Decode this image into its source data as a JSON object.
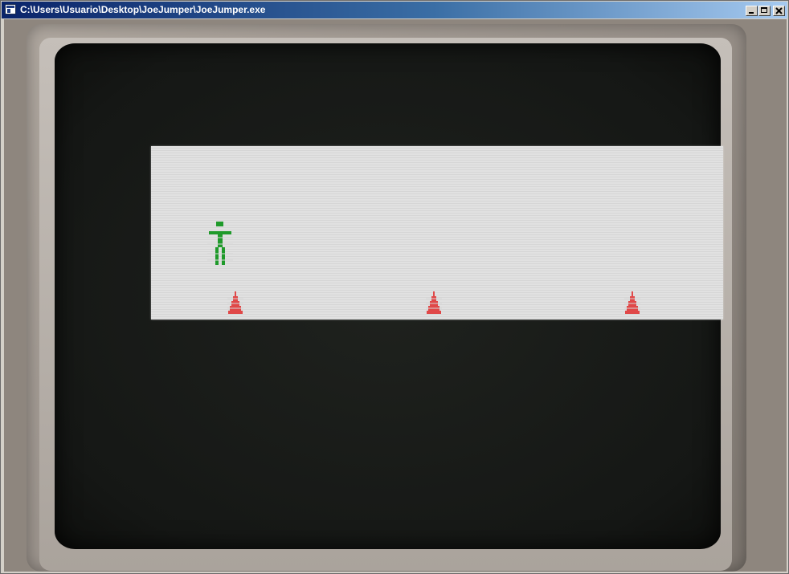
{
  "window": {
    "title": "C:\\Users\\Usuario\\Desktop\\JoeJumper\\JoeJumper.exe",
    "controls": [
      "minimize-icon",
      "maximize-icon",
      "close-icon"
    ]
  },
  "game": {
    "background_color": "#151715",
    "playfield_color": "#e1e1e1",
    "player": {
      "name": "joe",
      "color": "#1f9a2a"
    },
    "obstacles": [
      {
        "type": "cone",
        "color": "#e04848"
      },
      {
        "type": "cone",
        "color": "#e04848"
      },
      {
        "type": "cone",
        "color": "#e04848"
      }
    ]
  }
}
